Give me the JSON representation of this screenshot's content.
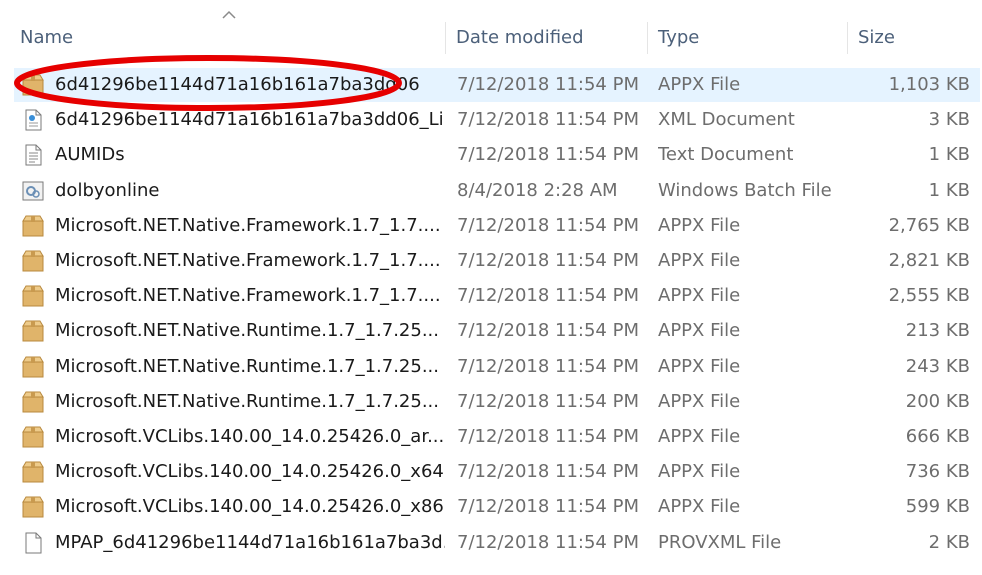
{
  "columns": {
    "name": "Name",
    "date": "Date modified",
    "type": "Type",
    "size": "Size"
  },
  "files": [
    {
      "name": "6d41296be1144d71a16b161a7ba3dd06",
      "date": "7/12/2018 11:54 PM",
      "type": "APPX File",
      "size": "1,103 KB",
      "icon": "package-icon",
      "selected": true
    },
    {
      "name": "6d41296be1144d71a16b161a7ba3dd06_Li...",
      "date": "7/12/2018 11:54 PM",
      "type": "XML Document",
      "size": "3 KB",
      "icon": "xml-document-icon"
    },
    {
      "name": "AUMIDs",
      "date": "7/12/2018 11:54 PM",
      "type": "Text Document",
      "size": "1 KB",
      "icon": "text-document-icon"
    },
    {
      "name": "dolbyonline",
      "date": "8/4/2018 2:28 AM",
      "type": "Windows Batch File",
      "size": "1 KB",
      "icon": "batch-file-icon"
    },
    {
      "name": "Microsoft.NET.Native.Framework.1.7_1.7....",
      "date": "7/12/2018 11:54 PM",
      "type": "APPX File",
      "size": "2,765 KB",
      "icon": "package-icon"
    },
    {
      "name": "Microsoft.NET.Native.Framework.1.7_1.7....",
      "date": "7/12/2018 11:54 PM",
      "type": "APPX File",
      "size": "2,821 KB",
      "icon": "package-icon"
    },
    {
      "name": "Microsoft.NET.Native.Framework.1.7_1.7....",
      "date": "7/12/2018 11:54 PM",
      "type": "APPX File",
      "size": "2,555 KB",
      "icon": "package-icon"
    },
    {
      "name": "Microsoft.NET.Native.Runtime.1.7_1.7.25...",
      "date": "7/12/2018 11:54 PM",
      "type": "APPX File",
      "size": "213 KB",
      "icon": "package-icon"
    },
    {
      "name": "Microsoft.NET.Native.Runtime.1.7_1.7.25...",
      "date": "7/12/2018 11:54 PM",
      "type": "APPX File",
      "size": "243 KB",
      "icon": "package-icon"
    },
    {
      "name": "Microsoft.NET.Native.Runtime.1.7_1.7.25...",
      "date": "7/12/2018 11:54 PM",
      "type": "APPX File",
      "size": "200 KB",
      "icon": "package-icon"
    },
    {
      "name": "Microsoft.VCLibs.140.00_14.0.25426.0_ar...",
      "date": "7/12/2018 11:54 PM",
      "type": "APPX File",
      "size": "666 KB",
      "icon": "package-icon"
    },
    {
      "name": "Microsoft.VCLibs.140.00_14.0.25426.0_x64...",
      "date": "7/12/2018 11:54 PM",
      "type": "APPX File",
      "size": "736 KB",
      "icon": "package-icon"
    },
    {
      "name": "Microsoft.VCLibs.140.00_14.0.25426.0_x86...",
      "date": "7/12/2018 11:54 PM",
      "type": "APPX File",
      "size": "599 KB",
      "icon": "package-icon"
    },
    {
      "name": "MPAP_6d41296be1144d71a16b161a7ba3d...",
      "date": "7/12/2018 11:54 PM",
      "type": "PROVXML File",
      "size": "2 KB",
      "icon": "blank-file-icon"
    }
  ],
  "colors": {
    "highlight_ring": "#e60000",
    "selection": "#e5f3ff",
    "header_text": "#4c607a"
  }
}
